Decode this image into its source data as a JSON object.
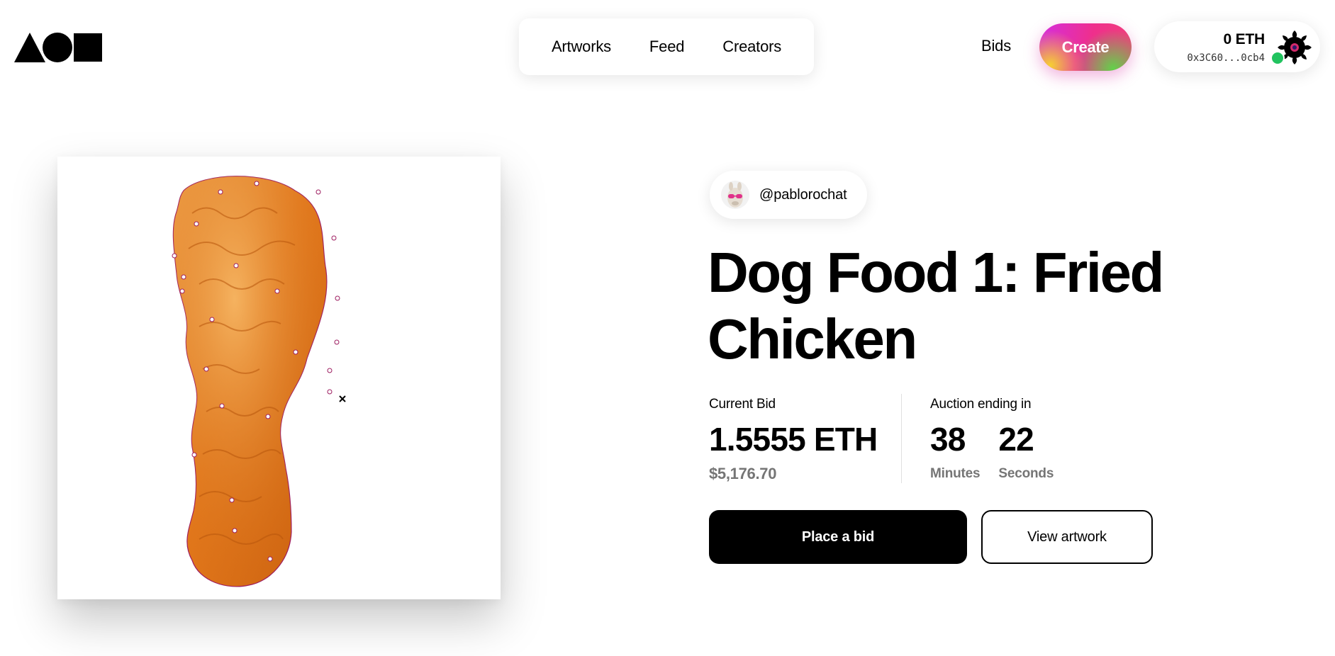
{
  "header": {
    "logo": "triangle-circle-square-logo",
    "nav": [
      "Artworks",
      "Feed",
      "Creators"
    ],
    "bids_label": "Bids",
    "create_label": "Create",
    "wallet": {
      "balance": "0 ETH",
      "address": "0x3C60...0cb4",
      "status": "online",
      "status_color": "#21c35f"
    }
  },
  "artwork": {
    "image_subject": "fried chicken drumstick",
    "creator_handle": "@pablorochat",
    "title": "Dog Food 1: Fried Chicken"
  },
  "auction": {
    "current_bid_label": "Current Bid",
    "current_bid_value": "1.5555 ETH",
    "current_bid_usd": "$5,176.70",
    "ending_label": "Auction ending in",
    "countdown": [
      {
        "value": "38",
        "unit": "Minutes"
      },
      {
        "value": "22",
        "unit": "Seconds"
      }
    ]
  },
  "actions": {
    "place_bid": "Place a bid",
    "view_artwork": "View artwork"
  },
  "colors": {
    "primary": "#000000",
    "muted_text": "#757575",
    "create_gradient": [
      "#d42ee0",
      "#ef2f8c",
      "#f6cf32",
      "#63d04a"
    ]
  }
}
